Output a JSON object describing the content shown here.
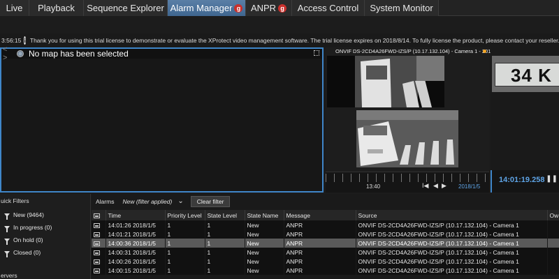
{
  "tabs": [
    {
      "label": "Live",
      "badge": ""
    },
    {
      "label": "Playback",
      "badge": ""
    },
    {
      "label": "Sequence Explorer",
      "badge": ""
    },
    {
      "label": "Alarm Manager",
      "badge": "g"
    },
    {
      "label": "ANPR",
      "badge": "g"
    },
    {
      "label": "Access Control",
      "badge": ""
    },
    {
      "label": "System Monitor",
      "badge": ""
    }
  ],
  "notice": {
    "time": "3:56:15",
    "text": "Thank you for using this trial license to demonstrate or evaluate the XProtect video management software. The trial license expires on 2018/8/14. To fully license the product, please contact your reseller..."
  },
  "map": {
    "title": "No map has been selected"
  },
  "camera": {
    "title": "ONVIF DS-2CD4A26FWD-IZS/P (10.17.132.104) - Camera 1 - 201...",
    "timeline_label": "13:40",
    "timeline_date": "2018/1/5"
  },
  "anpr_view": {
    "plate": "34 K",
    "time": "14:01:19.258"
  },
  "quick_filters": {
    "title": "uick Filters",
    "items": [
      {
        "label": "New (9464)"
      },
      {
        "label": "In progress (0)"
      },
      {
        "label": "On hold (0)"
      },
      {
        "label": "Closed (0)"
      }
    ],
    "servers": "ervers"
  },
  "alarms": {
    "label": "Alarms",
    "filter": "New (filter applied)",
    "clear_filter": "Clear filter",
    "columns": [
      "Time",
      "Priority Level",
      "State Level",
      "State Name",
      "Message",
      "Source",
      "Ow"
    ],
    "rows": [
      {
        "time": "14:01:26 2018/1/5",
        "priority": "1",
        "state_level": "1",
        "state_name": "New",
        "message": "ANPR",
        "source": "ONVIF DS-2CD4A26FWD-IZS/P (10.17.132.104) - Camera 1",
        "selected": false
      },
      {
        "time": "14:01:21 2018/1/5",
        "priority": "1",
        "state_level": "1",
        "state_name": "New",
        "message": "ANPR",
        "source": "ONVIF DS-2CD4A26FWD-IZS/P (10.17.132.104) - Camera 1",
        "selected": false
      },
      {
        "time": "14:00:36 2018/1/5",
        "priority": "1",
        "state_level": "1",
        "state_name": "New",
        "message": "ANPR",
        "source": "ONVIF DS-2CD4A26FWD-IZS/P (10.17.132.104) - Camera 1",
        "selected": true
      },
      {
        "time": "14:00:31 2018/1/5",
        "priority": "1",
        "state_level": "1",
        "state_name": "New",
        "message": "ANPR",
        "source": "ONVIF DS-2CD4A26FWD-IZS/P (10.17.132.104) - Camera 1",
        "selected": false
      },
      {
        "time": "14:00:26 2018/1/5",
        "priority": "1",
        "state_level": "1",
        "state_name": "New",
        "message": "ANPR",
        "source": "ONVIF DS-2CD4A26FWD-IZS/P (10.17.132.104) - Camera 1",
        "selected": false
      },
      {
        "time": "14:00:15 2018/1/5",
        "priority": "1",
        "state_level": "1",
        "state_name": "New",
        "message": "ANPR",
        "source": "ONVIF DS-2CD4A26FWD-IZS/P (10.17.132.104) - Camera 1",
        "selected": false
      }
    ]
  },
  "colors": {
    "accent": "#3f86c9",
    "badge": "#c9302c",
    "selected_row": "#5a5a5a"
  }
}
